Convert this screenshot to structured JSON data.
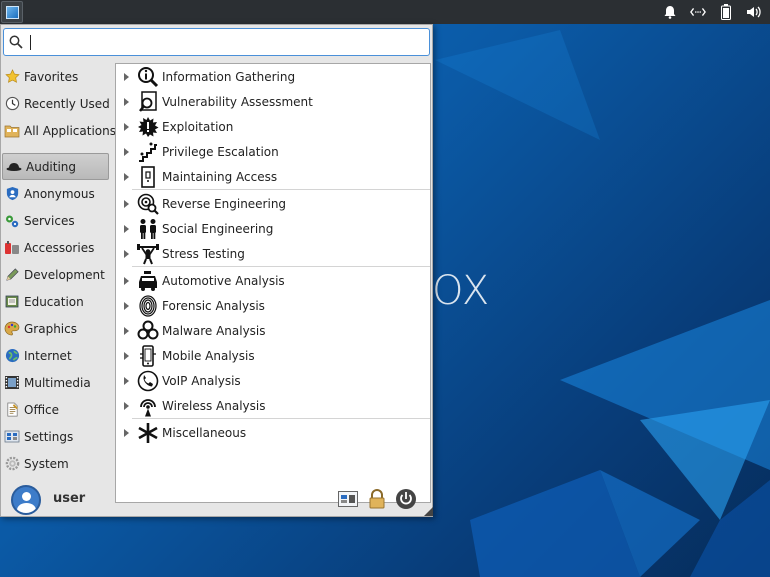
{
  "desktop": {
    "wallpaper_text": "OX"
  },
  "search": {
    "value": "",
    "placeholder": ""
  },
  "categories": [
    {
      "label": "Favorites",
      "icon": "star-icon"
    },
    {
      "label": "Recently Used",
      "icon": "clock-icon"
    },
    {
      "label": "All Applications",
      "icon": "folder-icon"
    },
    {
      "label": "Auditing",
      "icon": "hat-icon",
      "active": true
    },
    {
      "label": "Anonymous",
      "icon": "user-shield-icon"
    },
    {
      "label": "Services",
      "icon": "gears-icon"
    },
    {
      "label": "Accessories",
      "icon": "toolbox-icon"
    },
    {
      "label": "Development",
      "icon": "pencil-icon"
    },
    {
      "label": "Education",
      "icon": "book-icon"
    },
    {
      "label": "Graphics",
      "icon": "palette-icon"
    },
    {
      "label": "Internet",
      "icon": "globe-icon"
    },
    {
      "label": "Multimedia",
      "icon": "film-icon"
    },
    {
      "label": "Office",
      "icon": "document-icon"
    },
    {
      "label": "Settings",
      "icon": "settings-panel-icon"
    },
    {
      "label": "System",
      "icon": "system-gear-icon"
    }
  ],
  "apps": {
    "group1": [
      {
        "label": "Information Gathering",
        "icon": "magnifier-info-icon"
      },
      {
        "label": "Vulnerability Assessment",
        "icon": "doc-search-icon"
      },
      {
        "label": "Exploitation",
        "icon": "burst-icon"
      },
      {
        "label": "Privilege Escalation",
        "icon": "stairs-icon"
      },
      {
        "label": "Maintaining Access",
        "icon": "door-icon"
      }
    ],
    "group2": [
      {
        "label": "Reverse Engineering",
        "icon": "target-search-icon"
      },
      {
        "label": "Social Engineering",
        "icon": "people-icon"
      },
      {
        "label": "Stress Testing",
        "icon": "weight-lifter-icon"
      }
    ],
    "group3": [
      {
        "label": "Automotive Analysis",
        "icon": "car-icon"
      },
      {
        "label": "Forensic Analysis",
        "icon": "fingerprint-icon"
      },
      {
        "label": "Malware Analysis",
        "icon": "biohazard-icon"
      },
      {
        "label": "Mobile Analysis",
        "icon": "mobile-icon"
      },
      {
        "label": "VoIP Analysis",
        "icon": "phone-icon"
      },
      {
        "label": "Wireless Analysis",
        "icon": "wireless-icon"
      }
    ],
    "group4": [
      {
        "label": "Miscellaneous",
        "icon": "asterisk-icon"
      }
    ]
  },
  "user": {
    "name": "user"
  },
  "colors": {
    "accent": "#4a90d9",
    "panel": "#2b2f33",
    "menu_bg": "#e6e6e6"
  }
}
